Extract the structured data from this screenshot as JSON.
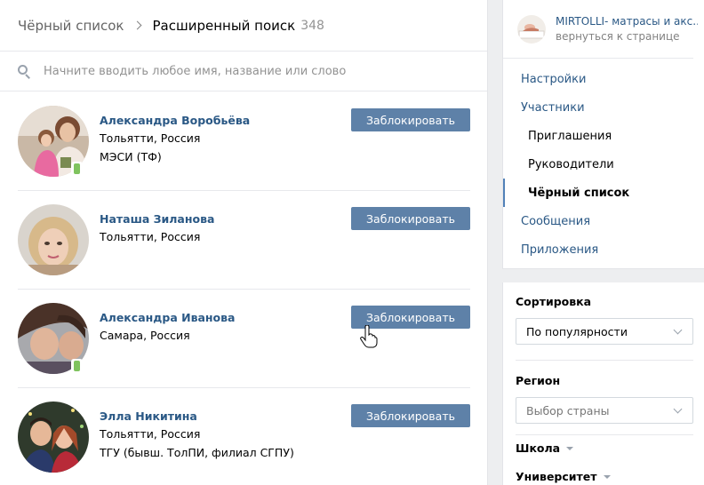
{
  "header": {
    "breadcrumb_parent": "Чёрный список",
    "title": "Расширенный поиск",
    "count": "348"
  },
  "search": {
    "placeholder": "Начните вводить любое имя, название или слово"
  },
  "results": [
    {
      "name": "Александра Воробьёва",
      "location": "Тольятти, Россия",
      "extra": "МЭСИ (ТФ)",
      "mobile": true,
      "button": "Заблокировать"
    },
    {
      "name": "Наташа Зиланова",
      "location": "Тольятти, Россия",
      "extra": "",
      "mobile": false,
      "button": "Заблокировать"
    },
    {
      "name": "Александра Иванова",
      "location": "Самара, Россия",
      "extra": "",
      "mobile": true,
      "button": "Заблокировать"
    },
    {
      "name": "Элла Никитина",
      "location": "Тольятти, Россия",
      "extra": "ТГУ (бывш. ТолПИ, филиал СГПУ)",
      "mobile": false,
      "button": "Заблокировать"
    }
  ],
  "sidebar": {
    "group_name": "MIRTOLLI- матрасы и акс...",
    "back_link": "вернуться к странице",
    "items": [
      {
        "label": "Настройки"
      },
      {
        "label": "Участники"
      },
      {
        "label": "Приглашения"
      },
      {
        "label": "Руководители"
      },
      {
        "label": "Чёрный список"
      },
      {
        "label": "Сообщения"
      },
      {
        "label": "Приложения"
      }
    ]
  },
  "filters": {
    "sort_label": "Сортировка",
    "sort_value": "По популярности",
    "region_label": "Регион",
    "region_placeholder": "Выбор страны",
    "school_label": "Школа",
    "university_label": "Университет"
  },
  "colors": {
    "link": "#2a5885",
    "button": "#5e81a8",
    "active_marker": "#5181b8",
    "online_mobile": "#7fc35e"
  }
}
